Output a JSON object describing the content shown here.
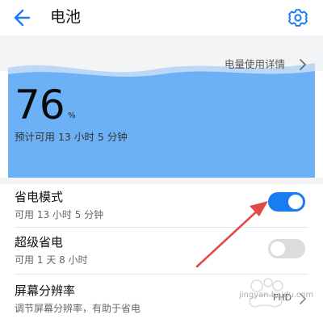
{
  "header": {
    "title": "电池",
    "back_icon": "back-arrow-icon",
    "settings_icon": "gear-icon"
  },
  "battery": {
    "usage_link": "电量使用详情",
    "percent": "76",
    "percent_unit": "%",
    "estimate": "预计可用 13 小时 5 分钟"
  },
  "settings": [
    {
      "title": "省电模式",
      "subtitle": "可用 13 小时 5 分钟",
      "toggle": true
    },
    {
      "title": "超级省电",
      "subtitle": "可用 1 天 8 小时",
      "toggle": false
    },
    {
      "title": "屏幕分辨率",
      "subtitle": "调节屏幕分辨率，有助于省电",
      "value": "FHD"
    }
  ],
  "watermark": "jingyan.baidu.com",
  "colors": {
    "accent": "#1a7cf3",
    "battery_blue": "#6cb0f5",
    "toggle_off": "#dcdcdc",
    "annotation": "#e24a4a"
  }
}
